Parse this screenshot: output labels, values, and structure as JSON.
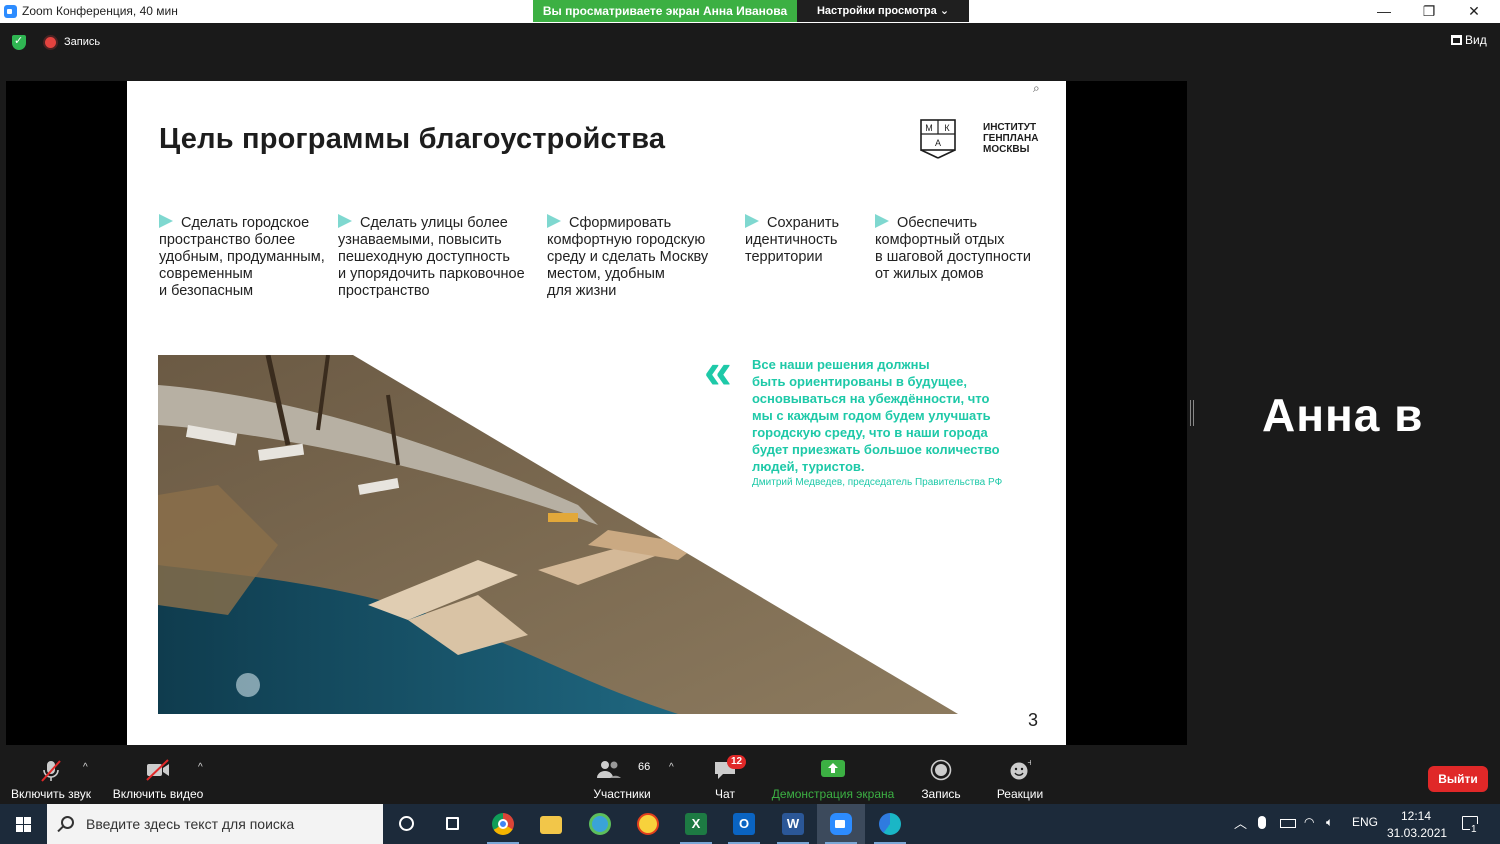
{
  "window": {
    "title": "Zoom Конференция, 40 мин",
    "share_banner": "Вы просматриваете экран Анна Иванова",
    "view_options": "Настройки просмотра ⌄",
    "minimize": "—",
    "maximize": "❐",
    "close": "✕"
  },
  "meeting_bar": {
    "record_label": "Запись",
    "view_label": "Вид"
  },
  "slide": {
    "title": "Цель программы благоустройства",
    "logo_letters": [
      "М",
      "К",
      "А"
    ],
    "logo_text": [
      "ИНСТИТУТ",
      "ГЕНПЛАНА",
      "МОСКВЫ"
    ],
    "goals": [
      [
        "Сделать городское",
        "пространство более",
        "удобным, продуманным,",
        "современным",
        "и безопасным"
      ],
      [
        "Сделать улицы более",
        "узнаваемыми, повысить",
        "пешеходную доступность",
        "и упорядочить парковочное",
        "пространство"
      ],
      [
        "Сформировать",
        "комфортную городскую",
        "среду и сделать Москву",
        "местом, удобным",
        "для жизни"
      ],
      [
        "Сохранить",
        "идентичность",
        "территории"
      ],
      [
        "Обеспечить",
        "комфортный отдых",
        "в шаговой доступности",
        "от жилых домов"
      ]
    ],
    "quote_mark": "«",
    "quote": [
      "Все наши решения должны",
      "быть ориентированы в будущее,",
      "основываться на убеждённости, что",
      "мы с каждым годом будем улучшать",
      "городскую среду, что в наши города",
      "будет приезжать большое количество",
      "людей, туристов."
    ],
    "quote_author": "Дмитрий Медведев, председатель Правительства РФ",
    "page_number": "3"
  },
  "participant": {
    "name": "Анна в"
  },
  "controls": {
    "audio": "Включить звук",
    "video": "Включить видео",
    "participants": "Участники",
    "participants_count": "66",
    "chat": "Чат",
    "chat_badge": "12",
    "share": "Демонстрация экрана",
    "record": "Запись",
    "reactions": "Реакции",
    "leave": "Выйти",
    "caret": "^"
  },
  "taskbar": {
    "search_placeholder": "Введите здесь текст для поиска",
    "language": "ENG",
    "time": "12:14",
    "date": "31.03.2021",
    "notification_count": "1",
    "apps": [
      "cortana",
      "task-view",
      "chrome",
      "file-explorer",
      "browser-globe",
      "1c",
      "excel",
      "outlook",
      "word",
      "zoom",
      "edge"
    ]
  },
  "colors": {
    "accent_green": "#3cb043",
    "teal": "#1ec9a8",
    "leave_red": "#e02828",
    "zoom_blue": "#2d8cff"
  }
}
